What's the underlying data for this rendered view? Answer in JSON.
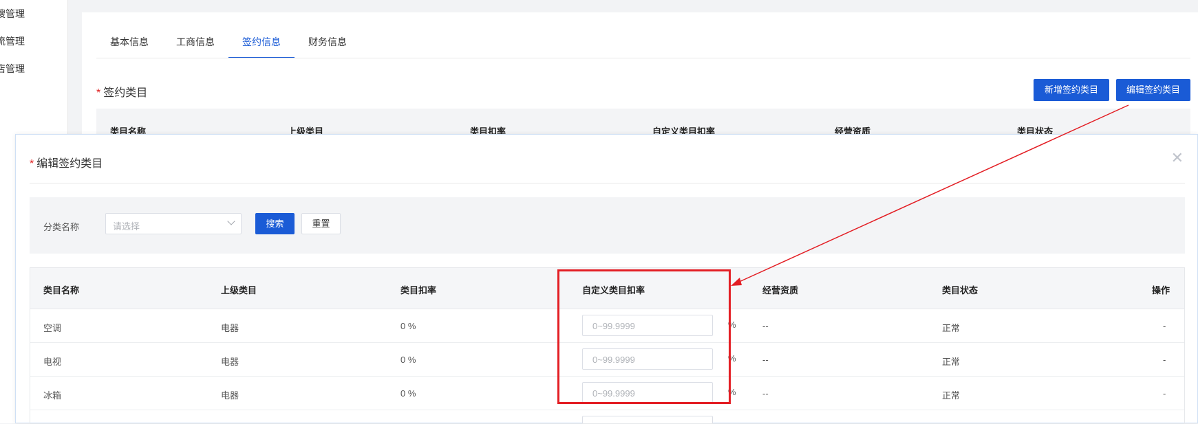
{
  "sidebar": {
    "items": [
      {
        "label": "搜管理"
      },
      {
        "label": "流管理"
      },
      {
        "label": "店管理"
      }
    ]
  },
  "tabs": [
    {
      "label": "基本信息"
    },
    {
      "label": "工商信息"
    },
    {
      "label": "签约信息",
      "active": true
    },
    {
      "label": "财务信息"
    }
  ],
  "section": {
    "required_mark": "*",
    "title": "签约类目",
    "add_button": "新增签约类目",
    "edit_button": "编辑签约类目",
    "columns": [
      "类目名称",
      "上级类目",
      "类目扣率",
      "自定义类目扣率",
      "经营资质",
      "类目状态"
    ]
  },
  "modal": {
    "required_mark": "*",
    "title": "编辑签约类目",
    "close_icon": "close-icon",
    "filter": {
      "label": "分类名称",
      "placeholder": "请选择",
      "search_button": "搜索",
      "reset_button": "重置"
    },
    "table": {
      "columns": [
        "类目名称",
        "上级类目",
        "类目扣率",
        "自定义类目扣率",
        "经营资质",
        "类目状态",
        "操作"
      ],
      "rows": [
        {
          "name": "空调",
          "parent": "电器",
          "rate": "0 %",
          "custom_placeholder": "0~99.9999",
          "unit": "%",
          "qualification": "--",
          "status": "正常",
          "action": "-"
        },
        {
          "name": "电视",
          "parent": "电器",
          "rate": "0 %",
          "custom_placeholder": "0~99.9999",
          "unit": "%",
          "qualification": "--",
          "status": "正常",
          "action": "-"
        },
        {
          "name": "冰箱",
          "parent": "电器",
          "rate": "0 %",
          "custom_placeholder": "0~99.9999",
          "unit": "%",
          "qualification": "--",
          "status": "正常",
          "action": "-"
        }
      ]
    }
  },
  "colors": {
    "primary": "#1a5bd6",
    "annotation": "#e31e24"
  }
}
